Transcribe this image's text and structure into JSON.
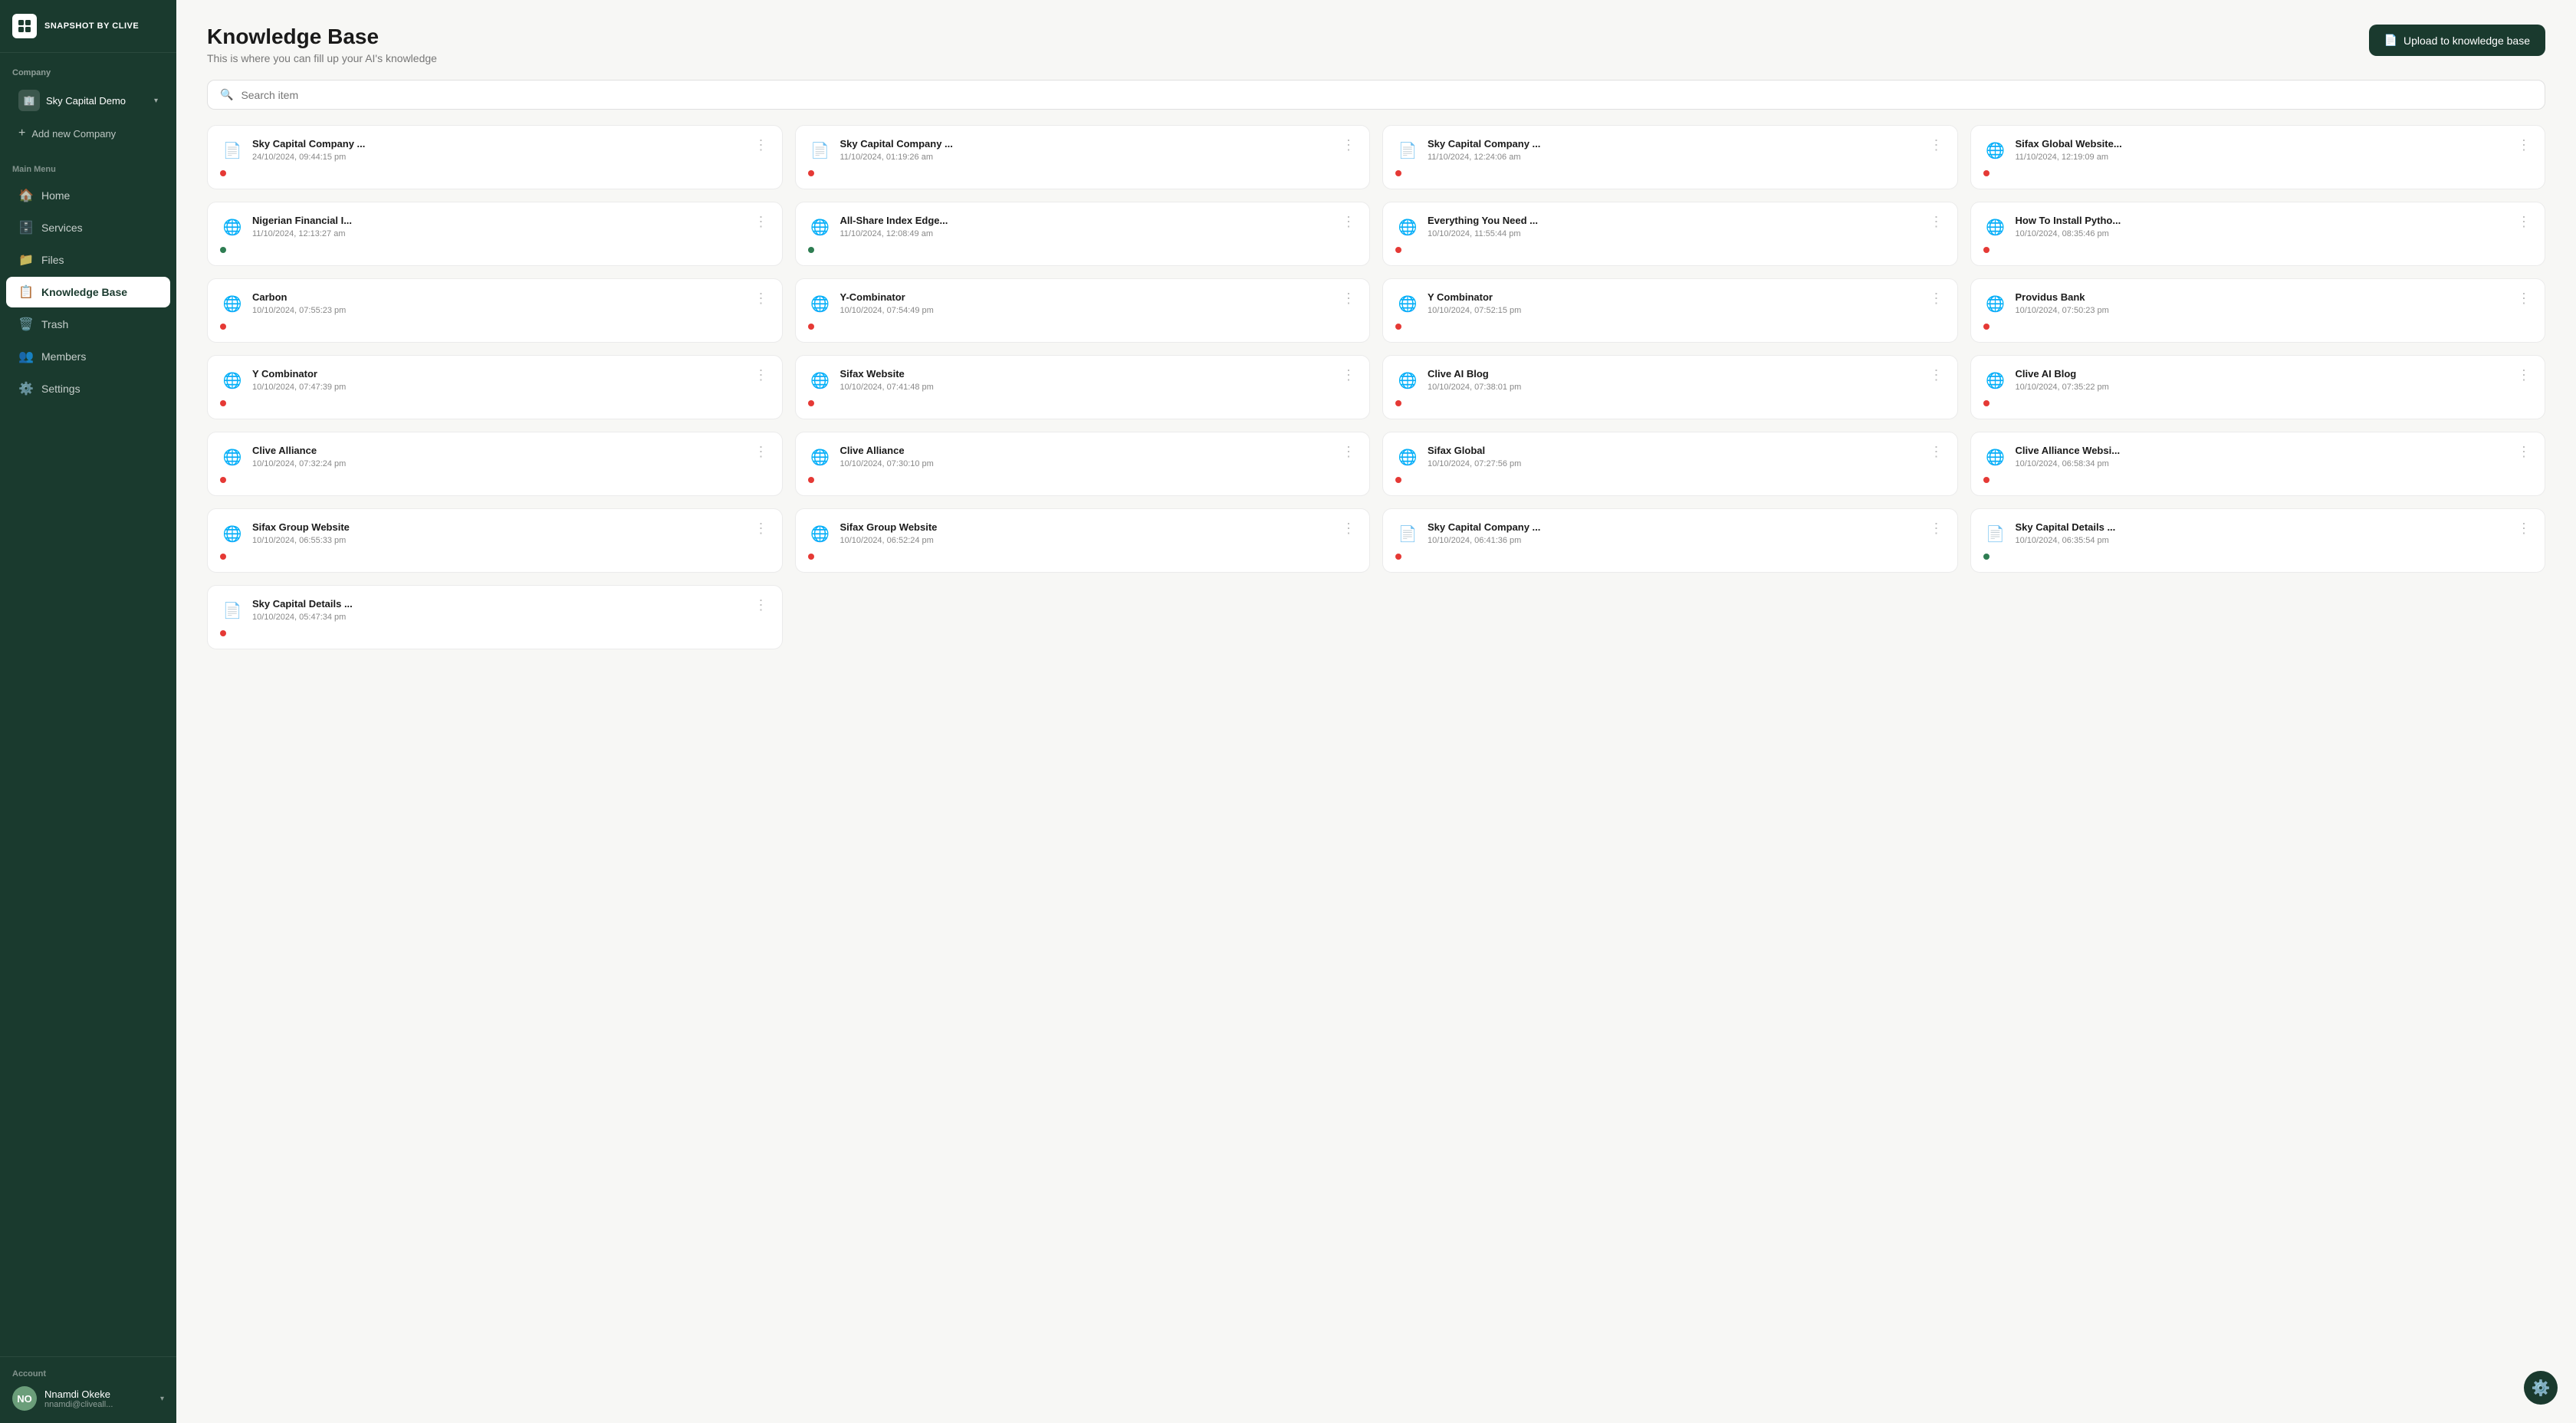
{
  "app": {
    "name": "SNAPSHOT BY CLIVE"
  },
  "sidebar": {
    "company_section": "Company",
    "company_name": "Sky Capital Demo",
    "add_company": "Add new Company",
    "main_menu": "Main Menu",
    "nav_items": [
      {
        "id": "home",
        "label": "Home",
        "icon": "🏠",
        "active": false
      },
      {
        "id": "services",
        "label": "Services",
        "icon": "🗄️",
        "active": false
      },
      {
        "id": "files",
        "label": "Files",
        "icon": "📁",
        "active": false
      },
      {
        "id": "knowledge-base",
        "label": "Knowledge Base",
        "icon": "📋",
        "active": true
      },
      {
        "id": "trash",
        "label": "Trash",
        "icon": "🗑️",
        "active": false
      },
      {
        "id": "members",
        "label": "Members",
        "icon": "👥",
        "active": false
      },
      {
        "id": "settings",
        "label": "Settings",
        "icon": "⚙️",
        "active": false
      }
    ],
    "account_section": "Account",
    "user": {
      "name": "Nnamdi Okeke",
      "email": "nnamdi@cliveall...",
      "initials": "NO"
    }
  },
  "page": {
    "title": "Knowledge Base",
    "subtitle": "This is where you can fill up your AI's knowledge",
    "upload_button": "Upload to knowledge base",
    "search_placeholder": "Search item"
  },
  "cards": [
    {
      "id": 1,
      "type": "pdf",
      "title": "Sky Capital Company ...",
      "date": "24/10/2024, 09:44:15 pm",
      "status": "red"
    },
    {
      "id": 2,
      "type": "pdf",
      "title": "Sky Capital Company ...",
      "date": "11/10/2024, 01:19:26 am",
      "status": "red"
    },
    {
      "id": 3,
      "type": "pdf",
      "title": "Sky Capital Company ...",
      "date": "11/10/2024, 12:24:06 am",
      "status": "red"
    },
    {
      "id": 4,
      "type": "web",
      "title": "Sifax Global Website...",
      "date": "11/10/2024, 12:19:09 am",
      "status": "red"
    },
    {
      "id": 5,
      "type": "web",
      "title": "Nigerian Financial I...",
      "date": "11/10/2024, 12:13:27 am",
      "status": "green"
    },
    {
      "id": 6,
      "type": "web",
      "title": "All-Share Index Edge...",
      "date": "11/10/2024, 12:08:49 am",
      "status": "green"
    },
    {
      "id": 7,
      "type": "web",
      "title": "Everything You Need ...",
      "date": "10/10/2024, 11:55:44 pm",
      "status": "red"
    },
    {
      "id": 8,
      "type": "web",
      "title": "How To Install Pytho...",
      "date": "10/10/2024, 08:35:46 pm",
      "status": "red"
    },
    {
      "id": 9,
      "type": "web",
      "title": "Carbon",
      "date": "10/10/2024, 07:55:23 pm",
      "status": "red"
    },
    {
      "id": 10,
      "type": "web",
      "title": "Y-Combinator",
      "date": "10/10/2024, 07:54:49 pm",
      "status": "red"
    },
    {
      "id": 11,
      "type": "web",
      "title": "Y Combinator",
      "date": "10/10/2024, 07:52:15 pm",
      "status": "red"
    },
    {
      "id": 12,
      "type": "web",
      "title": "Providus Bank",
      "date": "10/10/2024, 07:50:23 pm",
      "status": "red"
    },
    {
      "id": 13,
      "type": "web",
      "title": "Y Combinator",
      "date": "10/10/2024, 07:47:39 pm",
      "status": "red"
    },
    {
      "id": 14,
      "type": "web",
      "title": "Sifax Website",
      "date": "10/10/2024, 07:41:48 pm",
      "status": "red"
    },
    {
      "id": 15,
      "type": "web",
      "title": "Clive AI Blog",
      "date": "10/10/2024, 07:38:01 pm",
      "status": "red"
    },
    {
      "id": 16,
      "type": "web",
      "title": "Clive AI Blog",
      "date": "10/10/2024, 07:35:22 pm",
      "status": "red"
    },
    {
      "id": 17,
      "type": "web",
      "title": "Clive Alliance",
      "date": "10/10/2024, 07:32:24 pm",
      "status": "red"
    },
    {
      "id": 18,
      "type": "web",
      "title": "Clive Alliance",
      "date": "10/10/2024, 07:30:10 pm",
      "status": "red"
    },
    {
      "id": 19,
      "type": "web",
      "title": "Sifax Global",
      "date": "10/10/2024, 07:27:56 pm",
      "status": "red"
    },
    {
      "id": 20,
      "type": "web",
      "title": "Clive Alliance Websi...",
      "date": "10/10/2024, 06:58:34 pm",
      "status": "red"
    },
    {
      "id": 21,
      "type": "web",
      "title": "Sifax Group Website",
      "date": "10/10/2024, 06:55:33 pm",
      "status": "red"
    },
    {
      "id": 22,
      "type": "web",
      "title": "Sifax Group Website",
      "date": "10/10/2024, 06:52:24 pm",
      "status": "red"
    },
    {
      "id": 23,
      "type": "pdf",
      "title": "Sky Capital Company ...",
      "date": "10/10/2024, 06:41:36 pm",
      "status": "red"
    },
    {
      "id": 24,
      "type": "pdf",
      "title": "Sky Capital Details ...",
      "date": "10/10/2024, 06:35:54 pm",
      "status": "green"
    },
    {
      "id": 25,
      "type": "pdf",
      "title": "Sky Capital Details ...",
      "date": "10/10/2024, 05:47:34 pm",
      "status": "red"
    }
  ]
}
